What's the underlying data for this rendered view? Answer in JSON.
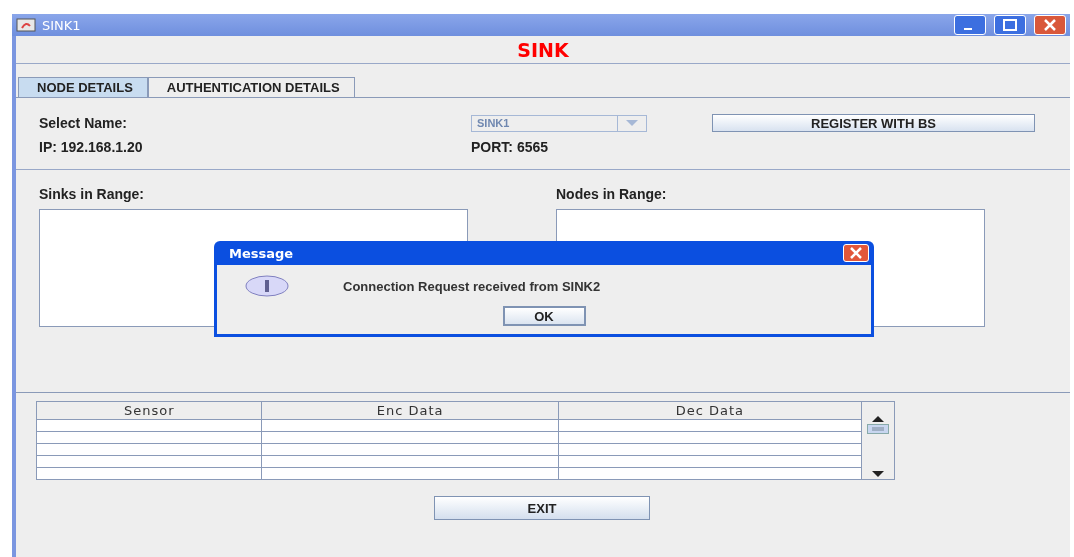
{
  "window": {
    "title": "SINK1"
  },
  "header": "SINK",
  "tabs": [
    {
      "label": "NODE DETAILS",
      "selected": true
    },
    {
      "label": "AUTHENTICATION DETAILS",
      "selected": false
    }
  ],
  "select_label": "Select Name:",
  "name_combo": {
    "value": "SINK1",
    "disabled": true
  },
  "register_button": "REGISTER WITH BS",
  "ip": "IP: 192.168.1.20",
  "port": "PORT: 6565",
  "sinks_label": "Sinks in Range:",
  "nodes_label": "Nodes in Range:",
  "table": {
    "columns": [
      "Sensor",
      "Enc Data",
      "Dec Data"
    ]
  },
  "exit_button": "EXIT",
  "dialog": {
    "title": "Message",
    "message": "Connection Request received from SINK2",
    "button": "OK"
  }
}
